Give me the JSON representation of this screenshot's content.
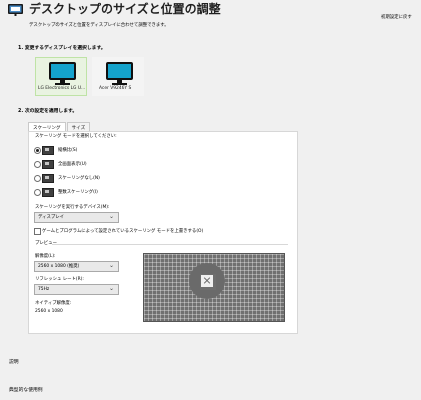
{
  "header": {
    "title": "デスクトップのサイズと位置の調整",
    "subtitle": "デスクトップのサイズと位置をディスプレイに合わせて調整できます。",
    "reset_link": "初期設定に戻す"
  },
  "section1": {
    "heading": "1. 変更するディスプレイを選択します。",
    "displays": [
      {
        "label": "LG Electronics LG U...",
        "selected": true
      },
      {
        "label": "Acer V9246Y S",
        "selected": false
      }
    ]
  },
  "section2": {
    "heading": "2. 次の設定を適用します。",
    "tabs": [
      "スケーリング",
      "サイズ"
    ],
    "scaling_mode_label": "スケーリング モードを選択してください:",
    "scaling_options": [
      {
        "label": "縦横比(S)",
        "checked": true
      },
      {
        "label": "全画面表示(U)",
        "checked": false
      },
      {
        "label": "スケーリングなし(N)",
        "checked": false
      },
      {
        "label": "整数スケーリング(I)",
        "checked": false
      }
    ],
    "device_label": "スケーリングを実行するデバイス(M):",
    "device_value": "ディスプレイ",
    "override_checkbox_label": "ゲームとプログラムによって設定されているスケーリング モードを上書きする(O)",
    "preview_title": "プレビュー",
    "resolution_label": "解像度(L):",
    "resolution_value": "2560 x 1080 (推奨)",
    "refresh_label": "リフレッシュ レート(R):",
    "refresh_value": "75Hz",
    "native_label": "ネイティブ解像度:",
    "native_value": "2560 x 1080"
  },
  "footer": {
    "description": "説明",
    "typical_use": "典型的な使用例"
  },
  "colors": {
    "panel": "#ffffff",
    "background": "#f0f0f0",
    "selected_border": "#bfe3a6",
    "screen": "#14a3cc"
  }
}
